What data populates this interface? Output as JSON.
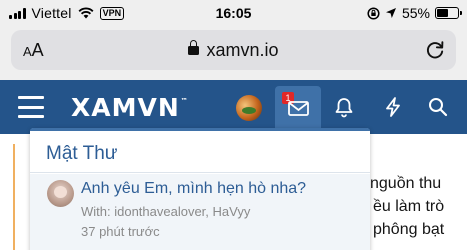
{
  "status_bar": {
    "carrier": "Viettel",
    "vpn_label": "VPN",
    "time": "16:05",
    "battery_percent": "55%",
    "battery_level": 0.55
  },
  "browser": {
    "text_size_label": "AA",
    "url": "xamvn.io"
  },
  "site_header": {
    "logo": "XAMVN",
    "logo_mark": "™",
    "icons": [
      "menu-icon",
      "user-avatar",
      "mail-icon",
      "bell-icon",
      "bolt-icon",
      "search-icon"
    ],
    "inbox_badge": "1",
    "colors": {
      "header_bg": "#24548a",
      "active_tab": "#3f71a8",
      "badge": "#e02828"
    }
  },
  "background_article": {
    "lines": [
      "nguồn thu",
      "ều làm trò",
      "phông bạt"
    ]
  },
  "inbox_popup": {
    "title": "Mật Thư",
    "conversations": [
      {
        "title": "Anh yêu Em, mình hẹn hò nha?",
        "participants": "With: idonthavealover, HaVyy",
        "time": "37 phút trước"
      }
    ]
  }
}
